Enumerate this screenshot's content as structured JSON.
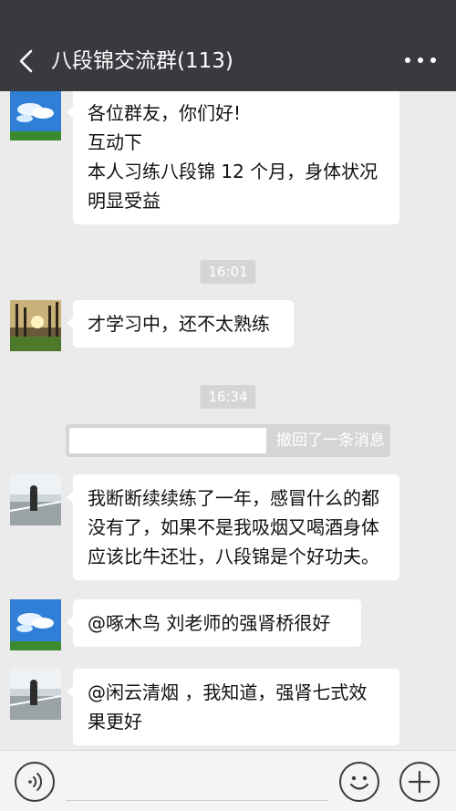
{
  "header": {
    "title": "八段锦交流群(113)"
  },
  "messages": [
    {
      "type": "text",
      "avatar": "sky-clouds-avatar",
      "lines": [
        "各位群友，你们好!",
        "互动下",
        "本人习练八段锦 12 个月，身体状况",
        "明显受益"
      ]
    },
    {
      "type": "time",
      "text": "16:01"
    },
    {
      "type": "text",
      "avatar": "sunset-trees-avatar",
      "lines": [
        "才学习中，还不太熟练"
      ]
    },
    {
      "type": "time",
      "text": "16:34"
    },
    {
      "type": "recall",
      "text": "撤回了一条消息"
    },
    {
      "type": "text",
      "avatar": "man-by-river-avatar",
      "lines": [
        "我断断续续练了一年，感冒什么的都",
        "没有了，如果不是我吸烟又喝酒身体",
        "应该比牛还壮，八段锦是个好功夫。"
      ]
    },
    {
      "type": "text",
      "avatar": "sky-clouds-avatar",
      "lines": [
        "@啄木鸟  刘老师的强肾桥很好"
      ]
    },
    {
      "type": "text",
      "avatar": "man-by-river-avatar",
      "lines": [
        "@闲云清烟  ，我知道，强肾七式效",
        "果更好"
      ]
    }
  ],
  "icons": {
    "back": "back-arrow-icon",
    "more": "more-dots-icon",
    "voice": "voice-icon",
    "emoji": "emoji-icon",
    "plus": "plus-icon"
  },
  "colors": {
    "header_bg": "#393a3f",
    "chat_bg": "#ebebeb",
    "bubble_bg": "#ffffff",
    "timestamp_bg": "#d5d5d5"
  }
}
